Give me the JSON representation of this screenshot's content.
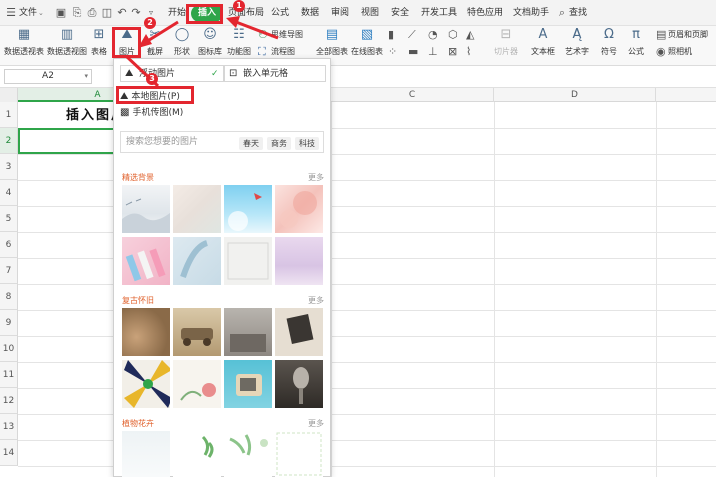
{
  "menubar": {
    "file": "文件",
    "tabs": [
      "开始",
      "插入",
      "页面布局",
      "公式",
      "数据",
      "审阅",
      "视图",
      "安全",
      "开发工具",
      "特色应用",
      "文档助手"
    ],
    "active_tab": "插入",
    "search": "查找"
  },
  "ribbon": {
    "pivot_table": "数据透视表",
    "pivot_chart": "数据透视图",
    "table": "表格",
    "picture": "图片",
    "screenshot": "截屏",
    "shapes": "形状",
    "icon_library": "图标库",
    "function_chart": "功能图",
    "mind_map": "思维导图",
    "flowchart": "流程图",
    "all_charts": "全部图表",
    "online_charts": "在线图表",
    "slicer": "切片器",
    "textbox": "文本框",
    "art_text": "艺术字",
    "symbol": "符号",
    "formula": "公式",
    "header_footer": "页眉和页脚",
    "camera": "照相机"
  },
  "formulabar": {
    "cell_ref": "A2"
  },
  "grid": {
    "columns": [
      "A",
      "B",
      "C",
      "D"
    ],
    "rows": [
      "1",
      "2",
      "3",
      "4",
      "5",
      "6",
      "7",
      "8",
      "9",
      "10",
      "11",
      "12",
      "13",
      "14"
    ],
    "a1_text": "插入图片"
  },
  "dropdown": {
    "float_picture": "浮动图片",
    "embed_cell": "嵌入单元格",
    "local_picture": "本地图片(P)",
    "phone_picture": "手机传图(M)",
    "search_placeholder": "搜索您想要的图片",
    "search_tags": [
      "春天",
      "商务",
      "科技"
    ],
    "more": "更多",
    "sections": [
      "精选背景",
      "复古怀旧",
      "植物花卉"
    ]
  },
  "annotations": {
    "badges": [
      "1",
      "2",
      "3"
    ]
  },
  "colors": {
    "accent": "#2fa54a",
    "annotation_red": "#e3262f",
    "section_title": "#e0612c"
  }
}
